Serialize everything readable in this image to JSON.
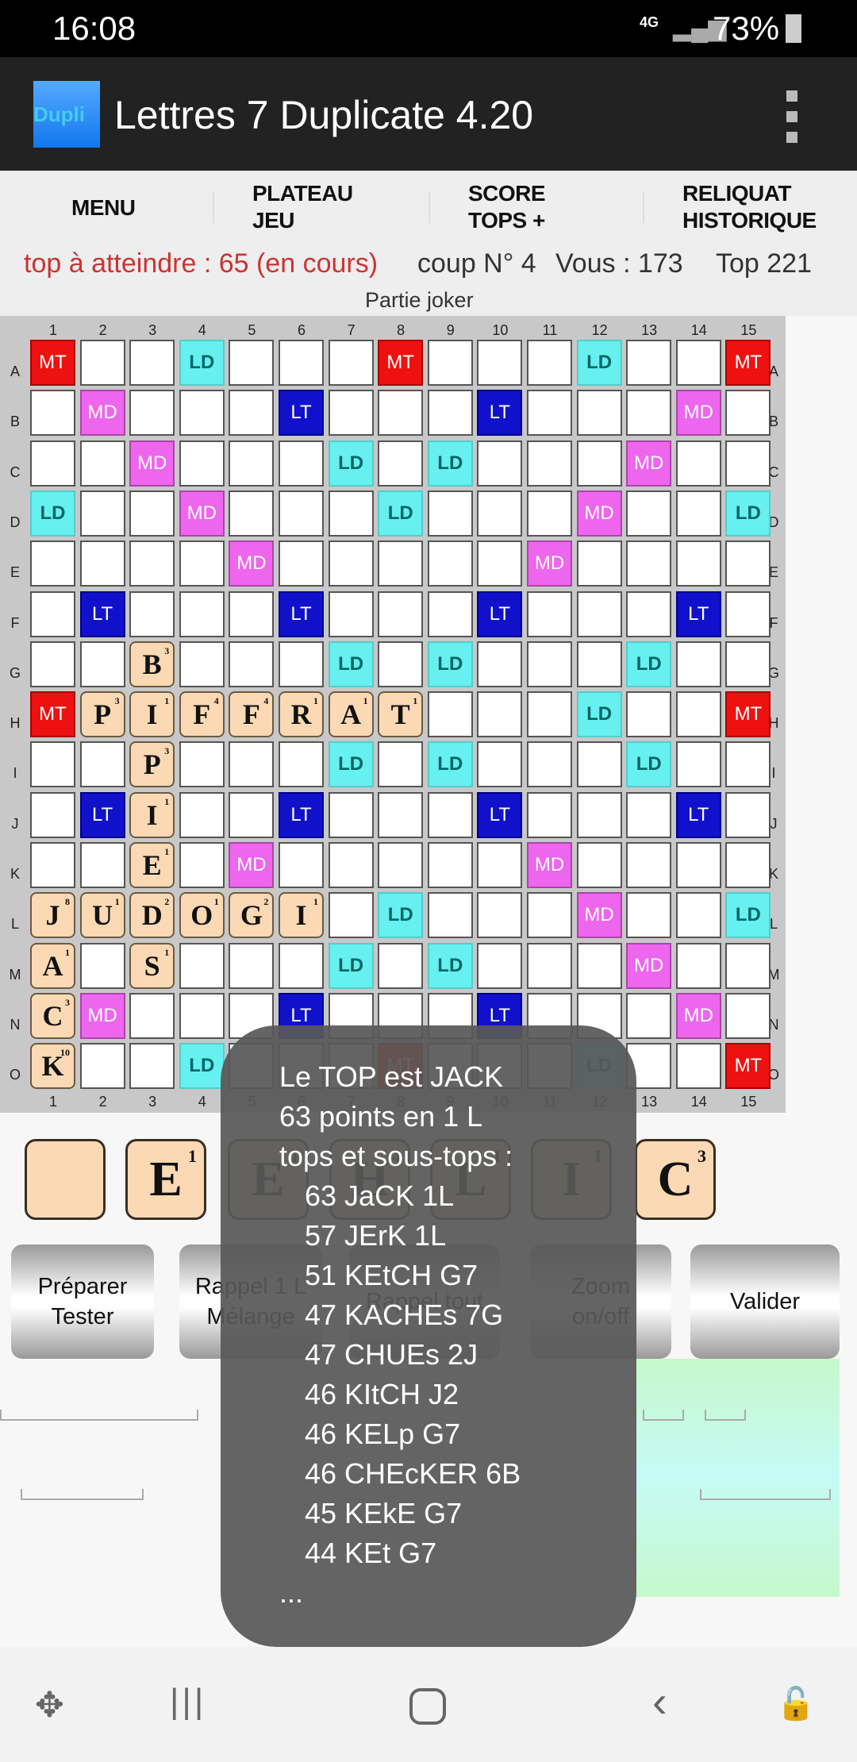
{
  "status": {
    "time": "16:08",
    "network": "4G",
    "battery": "73%"
  },
  "app": {
    "icon_text": "Dupli",
    "title": "Lettres 7 Duplicate 4.20",
    "menu_icon": "overflow-menu-icon"
  },
  "tabs": [
    {
      "l1": "MENU",
      "l2": ""
    },
    {
      "l1": "PLATEAU",
      "l2": "JEU"
    },
    {
      "l1": "SCORE",
      "l2": "TOPS +"
    },
    {
      "l1": "RELIQUAT",
      "l2": "HISTORIQUE"
    }
  ],
  "info": {
    "target": "top à atteindre : 65 (en cours)",
    "move": "coup N° 4",
    "you": "Vous : 173",
    "top": "Top 221",
    "mode": "Partie joker"
  },
  "board": {
    "columns": [
      "1",
      "2",
      "3",
      "4",
      "5",
      "6",
      "7",
      "8",
      "9",
      "10",
      "11",
      "12",
      "13",
      "14",
      "15"
    ],
    "rows": [
      "A",
      "B",
      "C",
      "D",
      "E",
      "F",
      "G",
      "H",
      "I",
      "J",
      "K",
      "L",
      "M",
      "N",
      "O"
    ],
    "premium_codes": {
      "T": "MT",
      "D": "MD",
      "t": "LT",
      "d": "LD"
    },
    "premium_rows": [
      "T..d...T...d..T",
      ".D...t...t...D.",
      "..D...d.d...D..",
      "d..D...d...D..d",
      "....D.....D....",
      ".t...t...t...t.",
      "..d...d.d...d..",
      "T..d...D...d..T",
      "..d...d.d...d..",
      ".t...t...t...t.",
      "....D.....D....",
      "d..D...d...D..d",
      "..D...d.d...D..",
      ".D...t...t...D.",
      "T..d...T...d..T"
    ],
    "tiles": [
      {
        "r": "G",
        "c": 3,
        "l": "B",
        "v": "3"
      },
      {
        "r": "H",
        "c": 2,
        "l": "P",
        "v": "3"
      },
      {
        "r": "H",
        "c": 3,
        "l": "I",
        "v": "1"
      },
      {
        "r": "H",
        "c": 4,
        "l": "F",
        "v": "4"
      },
      {
        "r": "H",
        "c": 5,
        "l": "F",
        "v": "4"
      },
      {
        "r": "H",
        "c": 6,
        "l": "R",
        "v": "1"
      },
      {
        "r": "H",
        "c": 7,
        "l": "A",
        "v": "1"
      },
      {
        "r": "H",
        "c": 8,
        "l": "T",
        "v": "1"
      },
      {
        "r": "I",
        "c": 3,
        "l": "P",
        "v": "3"
      },
      {
        "r": "J",
        "c": 3,
        "l": "I",
        "v": "1"
      },
      {
        "r": "K",
        "c": 3,
        "l": "E",
        "v": "1"
      },
      {
        "r": "L",
        "c": 1,
        "l": "J",
        "v": "8"
      },
      {
        "r": "L",
        "c": 2,
        "l": "U",
        "v": "1"
      },
      {
        "r": "L",
        "c": 3,
        "l": "D",
        "v": "2"
      },
      {
        "r": "L",
        "c": 4,
        "l": "O",
        "v": "1"
      },
      {
        "r": "L",
        "c": 5,
        "l": "G",
        "v": "2"
      },
      {
        "r": "L",
        "c": 6,
        "l": "I",
        "v": "1"
      },
      {
        "r": "M",
        "c": 1,
        "l": "A",
        "v": "1"
      },
      {
        "r": "M",
        "c": 3,
        "l": "S",
        "v": "1"
      },
      {
        "r": "N",
        "c": 1,
        "l": "C",
        "v": "3"
      },
      {
        "r": "O",
        "c": 1,
        "l": "K",
        "v": "10"
      }
    ]
  },
  "rack": [
    {
      "l": "",
      "v": ""
    },
    {
      "l": "E",
      "v": "1"
    },
    {
      "l": "E",
      "v": "1"
    },
    {
      "l": "H",
      "v": "4"
    },
    {
      "l": "L",
      "v": "1"
    },
    {
      "l": "I",
      "v": "1"
    },
    {
      "l": "C",
      "v": "3"
    }
  ],
  "buttons": [
    {
      "l1": "Préparer",
      "l2": "Tester"
    },
    {
      "l1": "Rappel 1 L",
      "l2": "Mélange"
    },
    {
      "l1": "Rappel tout",
      "l2": ""
    },
    {
      "l1": "Zoom",
      "l2": "on/off"
    },
    {
      "l1": "Valider",
      "l2": ""
    }
  ],
  "toast": {
    "line1": "Le TOP est JACK",
    "line2": "63 points en 1 L",
    "line3": "tops et sous-tops :",
    "moves": [
      "63 JaCK 1L",
      "57 JErK 1L",
      "51 KEtCH G7",
      "47 KACHEs 7G",
      "47 CHUEs 2J",
      "46 KItCH J2",
      "46 KELp G7",
      "46 CHEcKER 6B",
      "45 KEkE G7",
      "44 KEt G7"
    ],
    "more": "..."
  },
  "nav": [
    "game-icon",
    "recents-icon",
    "home-icon",
    "back-icon",
    "lock-touch-icon"
  ]
}
